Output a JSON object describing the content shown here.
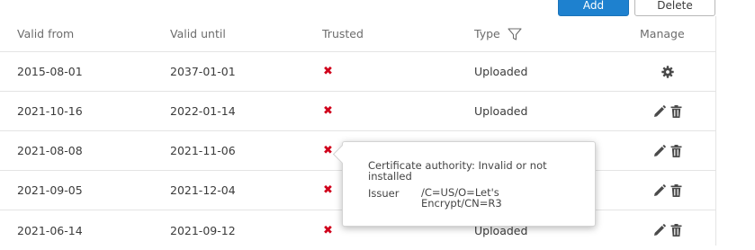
{
  "toolbar": {
    "add_label": "Add",
    "delete_label": "Delete"
  },
  "table": {
    "columns": {
      "valid_from": "Valid from",
      "valid_until": "Valid until",
      "trusted": "Trusted",
      "type": "Type",
      "manage": "Manage"
    },
    "rows": [
      {
        "valid_from": "2015-08-01",
        "valid_until": "2037-01-01",
        "trusted": "✖",
        "type": "Uploaded",
        "manage": "settings"
      },
      {
        "valid_from": "2021-10-16",
        "valid_until": "2022-01-14",
        "trusted": "✖",
        "type": "Uploaded",
        "manage": "edit-delete"
      },
      {
        "valid_from": "2021-08-08",
        "valid_until": "2021-11-06",
        "trusted": "✖",
        "type": "",
        "manage": "edit-delete"
      },
      {
        "valid_from": "2021-09-05",
        "valid_until": "2021-12-04",
        "trusted": "✖",
        "type": "",
        "manage": "edit-delete"
      },
      {
        "valid_from": "2021-06-14",
        "valid_until": "2021-09-12",
        "trusted": "✖",
        "type": "Uploaded",
        "manage": "edit-delete"
      }
    ]
  },
  "tooltip": {
    "description": "Certificate authority: Invalid or not installed",
    "issuer_label": "Issuer",
    "issuer_value": "/C=US/O=Let's Encrypt/CN=R3"
  },
  "colors": {
    "accent": "#1e81cf",
    "untrusted": "#d0021b",
    "border": "#e4e4e4"
  },
  "icons": [
    "filter-icon",
    "gear-icon",
    "pencil-icon",
    "trash-icon",
    "untrusted-x-icon"
  ]
}
